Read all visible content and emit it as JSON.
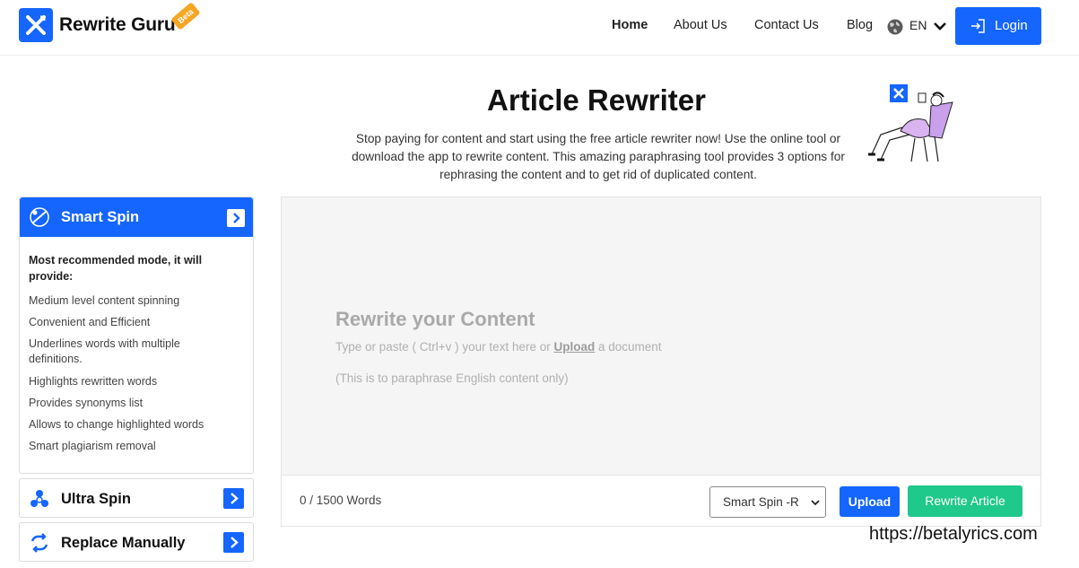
{
  "brand": {
    "name": "Rewrite Guru",
    "badge": "Beta"
  },
  "nav": {
    "home": "Home",
    "about": "About Us",
    "contact": "Contact Us",
    "blog": "Blog",
    "language": "EN",
    "login": "Login"
  },
  "hero": {
    "title": "Article Rewriter",
    "subtitle": "Stop paying for content and start using the free article rewriter now! Use the online tool or download the app to rewrite content. This amazing paraphrasing tool provides 3 options for rephrasing the content and to get rid of duplicated content."
  },
  "sidebar": {
    "smart_spin": {
      "title": "Smart Spin",
      "description": "Most recommended mode, it will provide:",
      "features": [
        "Medium level content spinning",
        "Convenient and Efficient",
        "Underlines words with multiple definitions.",
        "Highlights rewritten words",
        "Provides synonyms list",
        "Allows to change highlighted words",
        "Smart plagiarism removal"
      ]
    },
    "ultra_spin": {
      "title": "Ultra Spin"
    },
    "replace_manually": {
      "title": "Replace Manually"
    }
  },
  "editor": {
    "placeholder_title": "Rewrite your Content",
    "placeholder_prefix": "Type or paste ( Ctrl+v ) your text here or",
    "placeholder_link": "Upload",
    "placeholder_suffix": "a document",
    "note": "(This is to paraphrase English content only)",
    "word_count": "0 / 1500 Words",
    "mode_selected": "Smart Spin -R",
    "upload_label": "Upload",
    "rewrite_label": "Rewrite Article"
  },
  "watermark": "https://betalyrics.com",
  "colors": {
    "primary": "#1565ff",
    "success": "#1fc88b",
    "beta": "#f5a623"
  }
}
